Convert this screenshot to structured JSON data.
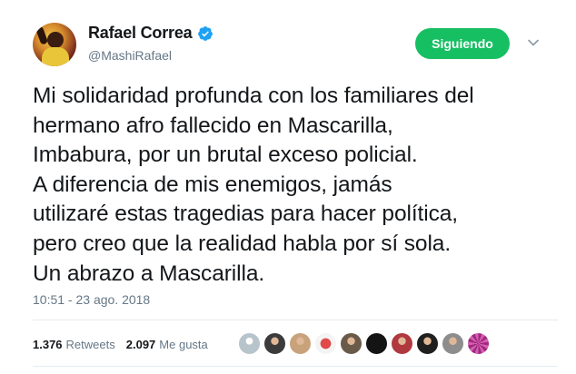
{
  "author": {
    "name": "Rafael Correa",
    "handle": "@MashiRafael",
    "verified": true
  },
  "follow_button": {
    "label": "Siguiendo",
    "color": "#17bf63"
  },
  "tweet": {
    "lines": [
      "Mi solidaridad profunda con los familiares del",
      "hermano afro fallecido en Mascarilla,",
      "Imbabura, por un brutal exceso policial.",
      "A diferencia de mis enemigos, jamás",
      "utilizaré estas tragedias para hacer política,",
      "pero creo que la realidad habla por sí sola.",
      "Un abrazo a Mascarilla."
    ],
    "timestamp": "10:51 - 23 ago. 2018"
  },
  "stats": {
    "retweets_count": "1.376",
    "retweets_label": "Retweets",
    "likes_count": "2.097",
    "likes_label": "Me gusta"
  },
  "likers": [
    {
      "icon": "avatar-default",
      "color": "#b8c4cc"
    },
    {
      "icon": "avatar-person",
      "color": "#3b3b3b"
    },
    {
      "icon": "avatar-person",
      "color": "#c8a27a"
    },
    {
      "icon": "avatar-logo",
      "color": "#e04a4a"
    },
    {
      "icon": "avatar-person",
      "color": "#6a5a4a"
    },
    {
      "icon": "avatar-dark",
      "color": "#141414"
    },
    {
      "icon": "avatar-person",
      "color": "#b0393f"
    },
    {
      "icon": "avatar-person",
      "color": "#1f1f1f"
    },
    {
      "icon": "avatar-person",
      "color": "#8d8d8d"
    },
    {
      "icon": "avatar-pattern",
      "color": "#a0287e"
    }
  ],
  "colors": {
    "text": "#14171a",
    "secondary": "#657786",
    "verified_badge": "#1da1f2"
  }
}
